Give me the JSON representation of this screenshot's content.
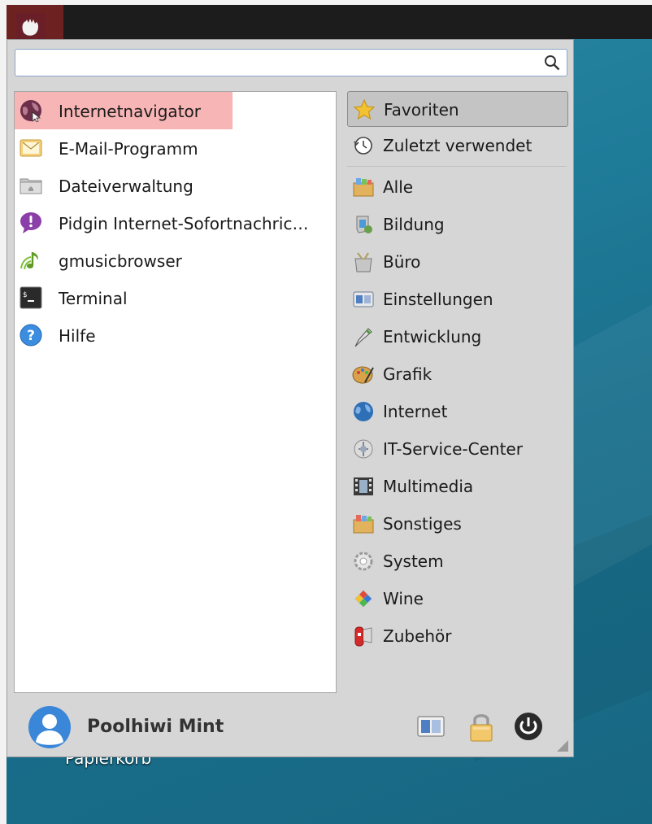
{
  "panel": {
    "menu_button_icon": "whisker-menu-icon"
  },
  "desktop": {
    "icon_label": "Papierkorb"
  },
  "search": {
    "value": "",
    "placeholder": ""
  },
  "favorites": [
    {
      "label": "Internetnavigator",
      "icon": "web-browser-icon"
    },
    {
      "label": "E-Mail-Programm",
      "icon": "mail-icon"
    },
    {
      "label": "Dateiverwaltung",
      "icon": "file-manager-icon"
    },
    {
      "label": "Pidgin Internet-Sofortnachric…",
      "icon": "pidgin-icon"
    },
    {
      "label": "gmusicbrowser",
      "icon": "music-icon"
    },
    {
      "label": "Terminal",
      "icon": "terminal-icon"
    },
    {
      "label": "Hilfe",
      "icon": "help-icon"
    }
  ],
  "categories": [
    {
      "label": "Favoriten",
      "icon": "star-icon"
    },
    {
      "label": "Zuletzt verwendet",
      "icon": "recent-icon"
    },
    {
      "label": "Alle",
      "icon": "all-apps-icon"
    },
    {
      "label": "Bildung",
      "icon": "education-icon"
    },
    {
      "label": "Büro",
      "icon": "office-icon"
    },
    {
      "label": "Einstellungen",
      "icon": "settings-icon"
    },
    {
      "label": "Entwicklung",
      "icon": "development-icon"
    },
    {
      "label": "Grafik",
      "icon": "graphics-icon"
    },
    {
      "label": "Internet",
      "icon": "internet-icon"
    },
    {
      "label": "IT-Service-Center",
      "icon": "service-center-icon"
    },
    {
      "label": "Multimedia",
      "icon": "multimedia-icon"
    },
    {
      "label": "Sonstiges",
      "icon": "other-icon"
    },
    {
      "label": "System",
      "icon": "system-icon"
    },
    {
      "label": "Wine",
      "icon": "wine-icon"
    },
    {
      "label": "Zubehör",
      "icon": "accessories-icon"
    }
  ],
  "user": {
    "name": "Poolhiwi Mint"
  },
  "colors": {
    "highlight": "#f07878",
    "panel": "#1c1c1c",
    "desktop": "#1f7c99",
    "menu_bg": "#d6d6d6"
  }
}
